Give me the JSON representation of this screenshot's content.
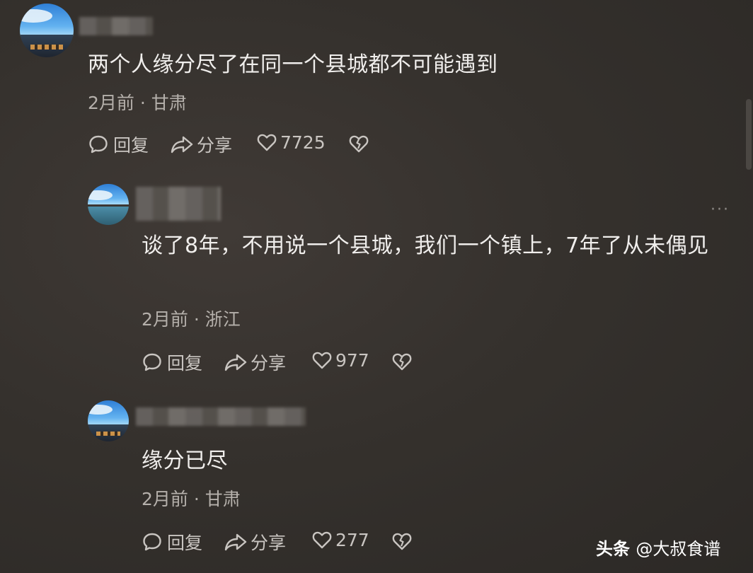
{
  "comments": [
    {
      "text": "两个人缘分尽了在同一个县城都不可能遇到",
      "time": "2月前",
      "sep": "·",
      "location": "甘肃",
      "reply_label": "回复",
      "share_label": "分享",
      "likes": "7725"
    },
    {
      "text": "谈了8年，不用说一个县城，我们一个镇上，7年了从未偶见",
      "time": "2月前",
      "sep": "·",
      "location": "浙江",
      "reply_label": "回复",
      "share_label": "分享",
      "likes": "977",
      "more": "···"
    },
    {
      "text": "缘分已尽",
      "time": "2月前",
      "sep": "·",
      "location": "甘肃",
      "reply_label": "回复",
      "share_label": "分享",
      "likes": "277"
    }
  ],
  "watermark": {
    "brand": "头条",
    "handle": "@大叔食谱"
  },
  "icons": {
    "reply": "speech-bubble-icon",
    "share": "share-arrow-icon",
    "like": "heart-icon",
    "dislike": "broken-heart-icon"
  }
}
